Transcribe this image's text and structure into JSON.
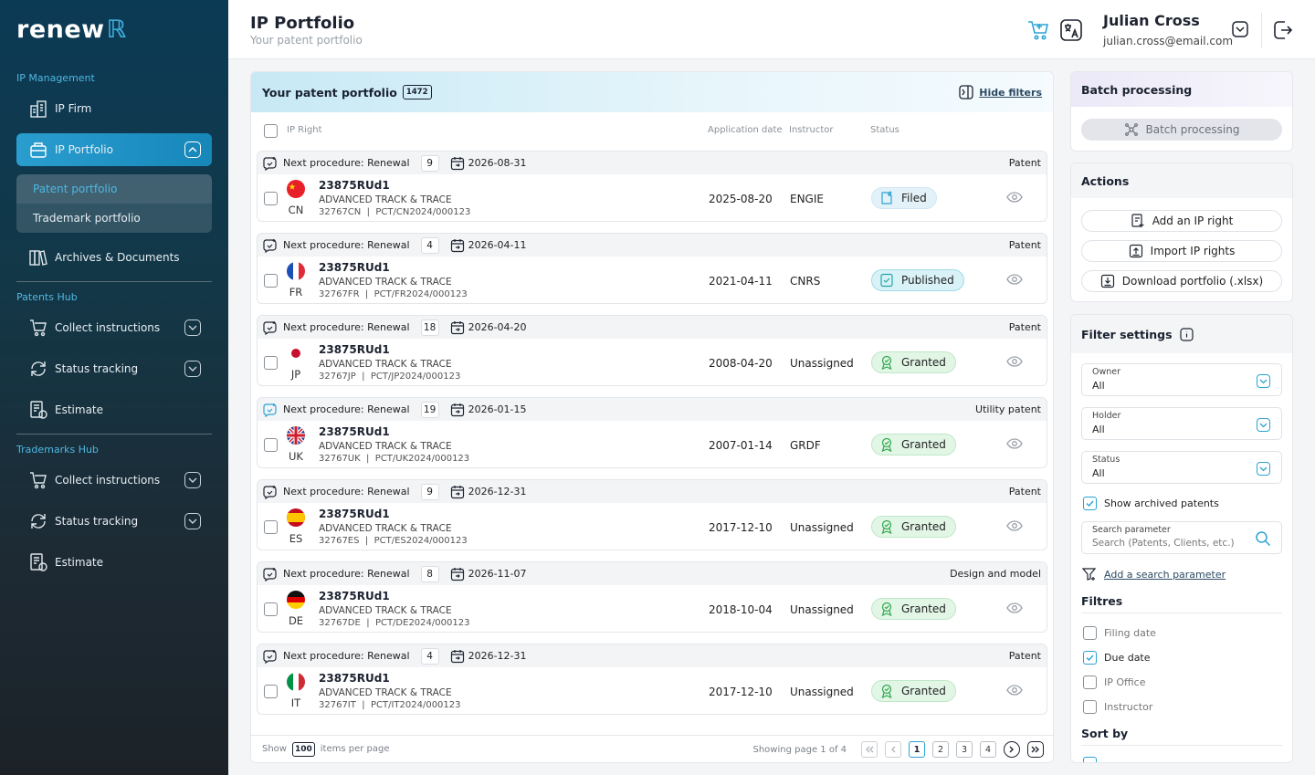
{
  "sidebar": {
    "logo_text": "renew",
    "logo_mark": "ℝ",
    "sections": {
      "ip_management": "IP Management",
      "patents_hub": "Patents Hub",
      "trademarks_hub": "Trademarks Hub"
    },
    "items": {
      "ip_firm": "IP Firm",
      "ip_portfolio": "IP Portfolio",
      "patent_portfolio": "Patent portfolio",
      "trademark_portfolio": "Trademark portfolio",
      "archives": "Archives & Documents",
      "p_collect": "Collect instructions",
      "p_status": "Status tracking",
      "p_estimate": "Estimate",
      "t_collect": "Collect instructions",
      "t_status": "Status tracking",
      "t_estimate": "Estimate"
    },
    "accent": "#2a9dcf"
  },
  "header": {
    "title": "IP Portfolio",
    "subtitle": "Your patent portfolio",
    "user_name": "Julian Cross",
    "user_email": "julian.cross@email.com"
  },
  "portfolio": {
    "title": "Your patent portfolio",
    "count": "1472",
    "hide_filters": "Hide filters",
    "columns": {
      "ip_right": "IP Right",
      "application_date": "Application date",
      "instructor": "Instructor",
      "status": "Status"
    },
    "rows": [
      {
        "next": "Next procedure: Renewal",
        "num": "9",
        "due": "2026-08-31",
        "type": "Patent",
        "cc": "CN",
        "ref": "23875RUd1",
        "company": "ADVANCED TRACK & TRACE",
        "code": "32767CN",
        "pct": "PCT/CN2024/000123",
        "app_date": "2025-08-20",
        "instructor": "ENGIE",
        "status": "Filed"
      },
      {
        "next": "Next procedure: Renewal",
        "num": "4",
        "due": "2026-04-11",
        "type": "Patent",
        "cc": "FR",
        "ref": "23875RUd1",
        "company": "ADVANCED TRACK & TRACE",
        "code": "32767FR",
        "pct": "PCT/FR2024/000123",
        "app_date": "2021-04-11",
        "instructor": "CNRS",
        "status": "Published"
      },
      {
        "next": "Next procedure: Renewal",
        "num": "18",
        "due": "2026-04-20",
        "type": "Patent",
        "cc": "JP",
        "ref": "23875RUd1",
        "company": "ADVANCED TRACK & TRACE",
        "code": "32767JP",
        "pct": "PCT/JP2024/000123",
        "app_date": "2008-04-20",
        "instructor": "Unassigned",
        "status": "Granted"
      },
      {
        "next": "Next procedure: Renewal",
        "num": "19",
        "due": "2026-01-15",
        "type": "Utility patent",
        "cc": "UK",
        "ref": "23875RUd1",
        "company": "ADVANCED TRACK & TRACE",
        "code": "32767UK",
        "pct": "PCT/UK2024/000123",
        "app_date": "2007-01-14",
        "instructor": "GRDF",
        "status": "Granted"
      },
      {
        "next": "Next procedure: Renewal",
        "num": "9",
        "due": "2026-12-31",
        "type": "Patent",
        "cc": "ES",
        "ref": "23875RUd1",
        "company": "ADVANCED TRACK & TRACE",
        "code": "32767ES",
        "pct": "PCT/ES2024/000123",
        "app_date": "2017-12-10",
        "instructor": "Unassigned",
        "status": "Granted"
      },
      {
        "next": "Next procedure: Renewal",
        "num": "8",
        "due": "2026-11-07",
        "type": "Design and model",
        "cc": "DE",
        "ref": "23875RUd1",
        "company": "ADVANCED TRACK & TRACE",
        "code": "32767DE",
        "pct": "PCT/DE2024/000123",
        "app_date": "2018-10-04",
        "instructor": "Unassigned",
        "status": "Granted"
      },
      {
        "next": "Next procedure: Renewal",
        "num": "4",
        "due": "2026-12-31",
        "type": "Patent",
        "cc": "IT",
        "ref": "23875RUd1",
        "company": "ADVANCED TRACK & TRACE",
        "code": "32767IT",
        "pct": "PCT/IT2024/000123",
        "app_date": "2017-12-10",
        "instructor": "Unassigned",
        "status": "Granted"
      }
    ],
    "footer": {
      "show": "Show",
      "per_page_value": "100",
      "items_per_page": "items per page",
      "page_info": "Showing page 1 of 4",
      "pages": [
        "1",
        "2",
        "3",
        "4"
      ]
    }
  },
  "batch": {
    "title": "Batch processing",
    "button": "Batch processing"
  },
  "actions": {
    "title": "Actions",
    "add": "Add an IP right",
    "import": "Import IP rights",
    "download": "Download portfolio (.xlsx)"
  },
  "filters": {
    "title": "Filter settings",
    "owner_label": "Owner",
    "owner_value": "All",
    "holder_label": "Holder",
    "holder_value": "All",
    "status_label": "Status",
    "status_value": "All",
    "show_archived": "Show archived patents",
    "search_label": "Search parameter",
    "search_placeholder": "Search (Patents, Clients, etc.)",
    "add_param": "Add a search parameter",
    "filtres_title": "Filtres",
    "filing_date": "Filing date",
    "due_date": "Due date",
    "ip_office": "IP Office",
    "instructor": "Instructor",
    "sort_by": "Sort by"
  }
}
